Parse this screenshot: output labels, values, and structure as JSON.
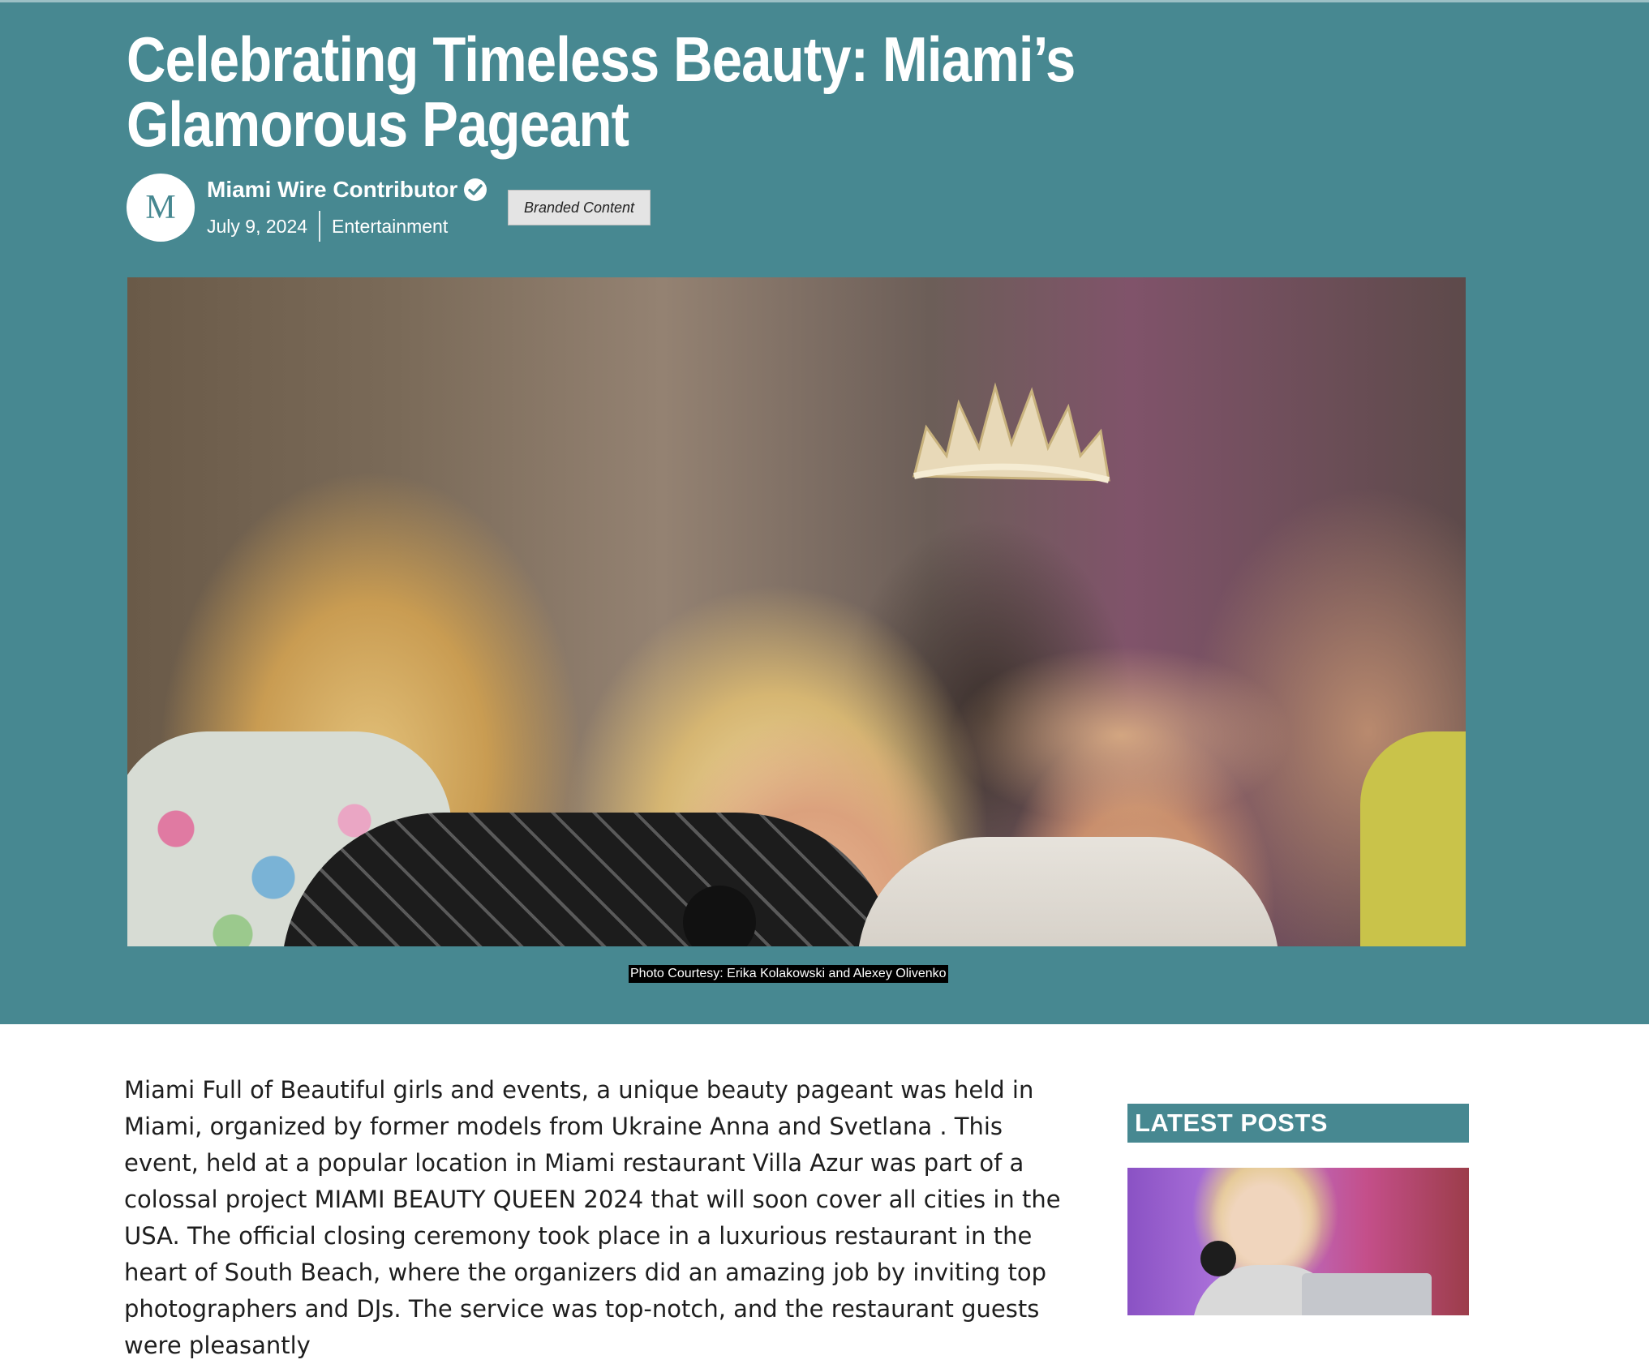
{
  "article": {
    "title": "Celebrating Timeless Beauty: Miami’s Glamorous Pageant",
    "author": {
      "initial": "M",
      "name": "Miami Wire Contributor",
      "verified_icon": "verified-check-icon"
    },
    "date": "July 9, 2024",
    "category": "Entertainment",
    "badge": "Branded Content",
    "photo_caption": "Photo Courtesy: Erika Kolakowski and Alexey Olivenko",
    "body": "Miami Full of Beautiful girls and events, a unique beauty pageant was held in Miami, organized by former models from Ukraine Anna and Svetlana . This event, held at a popular location in Miami restaurant Villa Azur  was part of a colossal project MIAMI BEAUTY QUEEN 2024  that will soon cover all cities in the USA. The official closing ceremony took place in a luxurious restaurant in the heart of South Beach, where the organizers did an amazing job by inviting top photographers and DJs. The service was top-notch, and the restaurant guests were pleasantly"
  },
  "sidebar": {
    "latest_posts_title": "LATEST POSTS"
  },
  "colors": {
    "hero_background": "#478891",
    "text": "#1e1e1e",
    "badge_background": "#e4e4e4"
  }
}
